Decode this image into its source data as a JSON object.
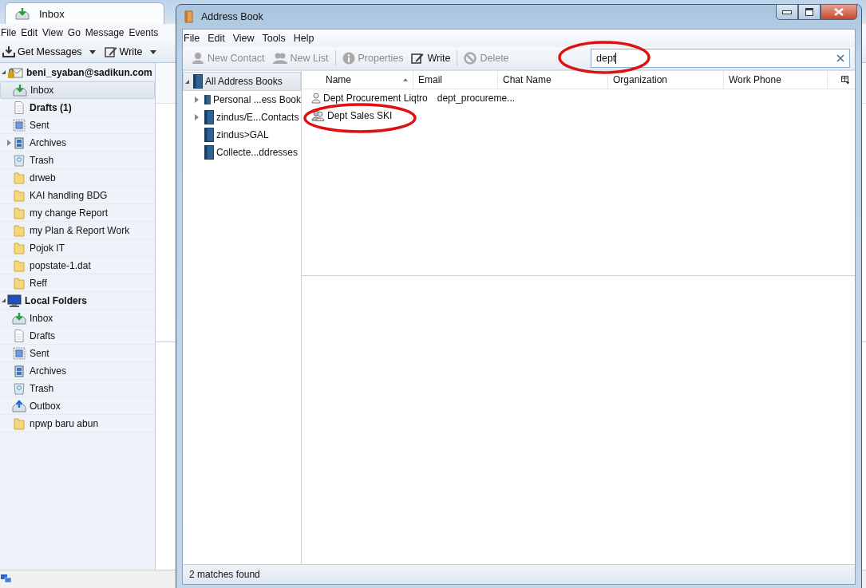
{
  "main_window": {
    "tab": {
      "title": "Inbox"
    },
    "menu": [
      "File",
      "Edit",
      "View",
      "Go",
      "Message",
      "Events"
    ],
    "toolbar": [
      {
        "label": "Get Messages",
        "kind": "get"
      },
      {
        "label": "Write",
        "kind": "write"
      }
    ],
    "folders": [
      {
        "label": "beni_syaban@sadikun.com",
        "kind": "account",
        "selected": false,
        "children": [
          {
            "label": "Inbox",
            "kind": "inbox",
            "selected": true
          },
          {
            "label": "Drafts (1)",
            "kind": "drafts",
            "selected": false,
            "unread": true
          },
          {
            "label": "Sent",
            "kind": "sent",
            "selected": false
          },
          {
            "label": "Archives",
            "kind": "archives",
            "selected": false,
            "expanded": false
          },
          {
            "label": "Trash",
            "kind": "trash",
            "selected": false
          },
          {
            "label": "drweb",
            "kind": "folder",
            "selected": false
          },
          {
            "label": "KAI handling BDG",
            "kind": "folder",
            "selected": false
          },
          {
            "label": "my change Report",
            "kind": "folder",
            "selected": false
          },
          {
            "label": "my Plan & Report Work",
            "kind": "folder",
            "selected": false
          },
          {
            "label": "Pojok IT",
            "kind": "folder",
            "selected": false
          },
          {
            "label": "popstate-1.dat",
            "kind": "folder",
            "selected": false
          },
          {
            "label": "Reff",
            "kind": "folder",
            "selected": false
          }
        ]
      },
      {
        "label": "Local Folders",
        "kind": "local",
        "selected": false,
        "children": [
          {
            "label": "Inbox",
            "kind": "inbox",
            "selected": false
          },
          {
            "label": "Drafts",
            "kind": "drafts",
            "selected": false
          },
          {
            "label": "Sent",
            "kind": "sent",
            "selected": false
          },
          {
            "label": "Archives",
            "kind": "archives",
            "selected": false
          },
          {
            "label": "Trash",
            "kind": "trash",
            "selected": false
          },
          {
            "label": "Outbox",
            "kind": "outbox",
            "selected": false
          },
          {
            "label": "npwp baru abun",
            "kind": "folder",
            "selected": false
          }
        ]
      }
    ]
  },
  "address_book": {
    "window": {
      "title": "Address Book"
    },
    "menu": [
      "File",
      "Edit",
      "View",
      "Tools",
      "Help"
    ],
    "toolbar": [
      {
        "label": "New Contact",
        "kind": "new-contact",
        "disabled": true
      },
      {
        "label": "New List",
        "kind": "new-list",
        "disabled": true
      },
      {
        "label": "Properties",
        "kind": "properties",
        "disabled": true
      },
      {
        "label": "Write",
        "kind": "write",
        "disabled": false
      },
      {
        "label": "Delete",
        "kind": "delete",
        "disabled": true
      }
    ],
    "search": {
      "value": "dept"
    },
    "books": [
      {
        "label": "All Address Books",
        "selected": true,
        "expanded": true,
        "children": [
          {
            "label": "Personal ...ess Book",
            "selected": false,
            "expanded": false
          },
          {
            "label": "zindus/E...Contacts",
            "selected": false,
            "expanded": false
          },
          {
            "label": "zindus>GAL",
            "selected": false
          },
          {
            "label": "Collecte...ddresses",
            "selected": false
          }
        ]
      }
    ],
    "table": {
      "columns": [
        {
          "label": "Name",
          "sorted": true
        },
        {
          "label": "Email",
          "sorted": false
        },
        {
          "label": "Chat Name",
          "sorted": false
        },
        {
          "label": "Organization",
          "sorted": false
        },
        {
          "label": "Work Phone",
          "sorted": false
        }
      ],
      "rows": [
        {
          "kind": "contact",
          "name": "Dept Procurement Liqtro",
          "email": "dept_procureme..."
        },
        {
          "kind": "list",
          "name": "Dept Sales SKI"
        }
      ]
    },
    "status_bar": "2 matches found"
  }
}
